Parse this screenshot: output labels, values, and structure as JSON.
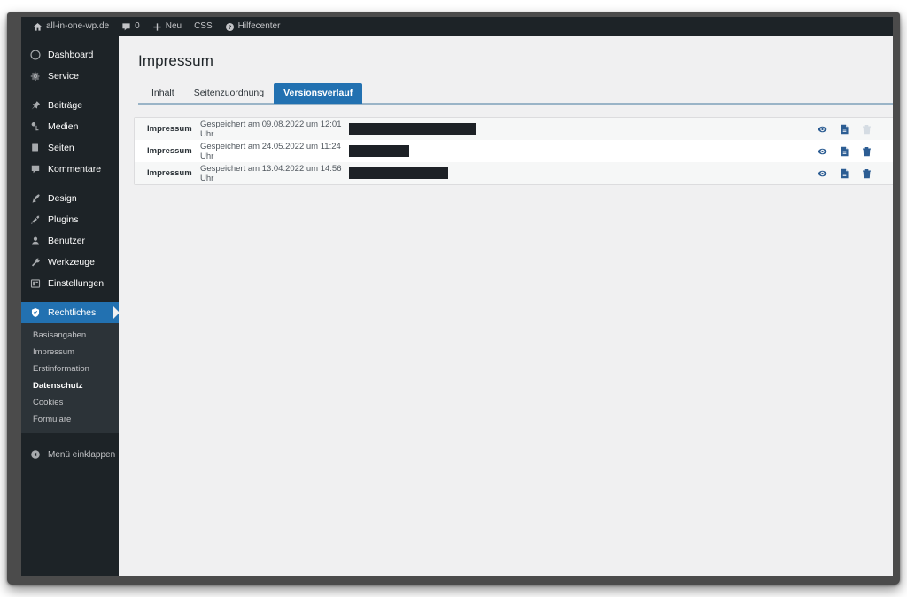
{
  "adminbar": {
    "site_icon": "home-icon",
    "site_name": "all-in-one-wp.de",
    "comments_icon": "comment-bubble-icon",
    "comments_count": "0",
    "new_icon": "plus-icon",
    "new_label": "Neu",
    "css_label": "CSS",
    "help_icon": "question-mark-icon",
    "help_label": "Hilfecenter"
  },
  "sidebar": {
    "groups": [
      {
        "items": [
          {
            "label": "Dashboard",
            "icon": "dashboard-icon"
          },
          {
            "label": "Service",
            "icon": "gear-icon"
          }
        ]
      },
      {
        "items": [
          {
            "label": "Beiträge",
            "icon": "pin-icon"
          },
          {
            "label": "Medien",
            "icon": "media-icon"
          },
          {
            "label": "Seiten",
            "icon": "page-icon"
          },
          {
            "label": "Kommentare",
            "icon": "comment-icon"
          }
        ]
      },
      {
        "items": [
          {
            "label": "Design",
            "icon": "brush-icon"
          },
          {
            "label": "Plugins",
            "icon": "plug-icon"
          },
          {
            "label": "Benutzer",
            "icon": "user-icon"
          },
          {
            "label": "Werkzeuge",
            "icon": "wrench-icon"
          },
          {
            "label": "Einstellungen",
            "icon": "sliders-icon"
          }
        ]
      }
    ],
    "current_item": {
      "label": "Rechtliches",
      "icon": "shield-icon"
    },
    "submenu": [
      {
        "label": "Basisangaben",
        "current": false
      },
      {
        "label": "Impressum",
        "current": false
      },
      {
        "label": "Erstinformation",
        "current": false
      },
      {
        "label": "Datenschutz",
        "current": true
      },
      {
        "label": "Cookies",
        "current": false
      },
      {
        "label": "Formulare",
        "current": false
      }
    ],
    "collapse": {
      "label": "Menü einklappen",
      "icon": "collapse-arrow-icon"
    }
  },
  "main": {
    "page_title": "Impressum",
    "tabs": [
      {
        "label": "Inhalt",
        "active": false
      },
      {
        "label": "Seitenzuordnung",
        "active": false
      },
      {
        "label": "Versionsverlauf",
        "active": true
      }
    ],
    "rows": [
      {
        "title": "Impressum",
        "date": "Gespeichert am 09.08.2022 um 12:01 Uhr",
        "redaction_width": 143,
        "actions": [
          {
            "name": "preview-icon",
            "disabled": false
          },
          {
            "name": "document-icon",
            "disabled": false
          },
          {
            "name": "trash-icon",
            "disabled": true
          }
        ]
      },
      {
        "title": "Impressum",
        "date": "Gespeichert am 24.05.2022 um 11:24 Uhr",
        "redaction_width": 68,
        "actions": [
          {
            "name": "preview-icon",
            "disabled": false
          },
          {
            "name": "document-icon",
            "disabled": false
          },
          {
            "name": "trash-icon",
            "disabled": false
          }
        ]
      },
      {
        "title": "Impressum",
        "date": "Gespeichert am 13.04.2022 um 14:56 Uhr",
        "redaction_width": 112,
        "actions": [
          {
            "name": "preview-icon",
            "disabled": false
          },
          {
            "name": "document-icon",
            "disabled": false
          },
          {
            "name": "trash-icon",
            "disabled": false
          }
        ]
      }
    ]
  },
  "colors": {
    "accent": "#2271b1",
    "sidebar_bg": "#1d2327",
    "submenu_bg": "#2c3338",
    "content_bg": "#f0f0f1",
    "frame": "#4b4b4b",
    "icon_blue": "#2c5d93",
    "redaction": "#1d2126"
  }
}
